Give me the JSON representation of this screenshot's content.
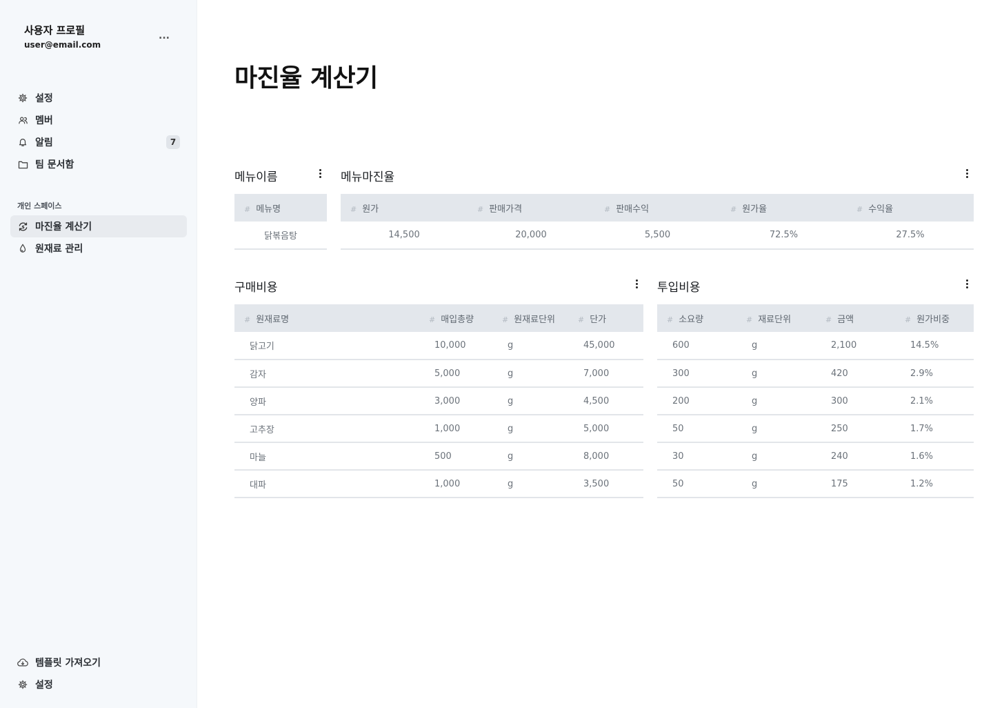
{
  "profile": {
    "name": "사용자 프로필",
    "email": "user@email.com",
    "more": "..."
  },
  "nav": {
    "items": [
      {
        "label": "설정",
        "icon": "gear-icon"
      },
      {
        "label": "멤버",
        "icon": "users-icon"
      },
      {
        "label": "알림",
        "icon": "bell-icon",
        "badge": "7"
      },
      {
        "label": "팀 문서함",
        "icon": "folder-icon"
      }
    ],
    "section_label": "개인 스페이스",
    "space_items": [
      {
        "label": "마진율 계산기",
        "icon": "currency-exchange-icon",
        "active": true
      },
      {
        "label": "원재료 관리",
        "icon": "drop-icon"
      }
    ],
    "bottom_items": [
      {
        "label": "템플릿 가져오기",
        "icon": "cloud-download-icon"
      },
      {
        "label": "설정",
        "icon": "gear-icon"
      }
    ]
  },
  "page": {
    "title": "마진율 계산기"
  },
  "menu_name": {
    "title": "메뉴이름",
    "header": "메뉴명",
    "value": "닭볶음탕"
  },
  "menu_margin": {
    "title": "메뉴마진율",
    "headers": [
      "원가",
      "판매가격",
      "판매수익",
      "원가율",
      "수익율"
    ],
    "row": [
      "14,500",
      "20,000",
      "5,500",
      "72.5%",
      "27.5%"
    ]
  },
  "purchase": {
    "title": "구매비용",
    "headers": [
      "원재료명",
      "매입총량",
      "원재료단위",
      "단가"
    ],
    "rows": [
      [
        "닭고기",
        "10,000",
        "g",
        "45,000"
      ],
      [
        "감자",
        "5,000",
        "g",
        "7,000"
      ],
      [
        "양파",
        "3,000",
        "g",
        "4,500"
      ],
      [
        "고추장",
        "1,000",
        "g",
        "5,000"
      ],
      [
        "마늘",
        "500",
        "g",
        "8,000"
      ],
      [
        "대파",
        "1,000",
        "g",
        "3,500"
      ]
    ]
  },
  "input_cost": {
    "title": "투입비용",
    "headers": [
      "소요량",
      "재료단위",
      "금액",
      "원가비중"
    ],
    "rows": [
      [
        "600",
        "g",
        "2,100",
        "14.5%"
      ],
      [
        "300",
        "g",
        "420",
        "2.9%"
      ],
      [
        "200",
        "g",
        "300",
        "2.1%"
      ],
      [
        "50",
        "g",
        "250",
        "1.7%"
      ],
      [
        "30",
        "g",
        "240",
        "1.6%"
      ],
      [
        "50",
        "g",
        "175",
        "1.2%"
      ]
    ]
  },
  "hash_symbol": "#"
}
